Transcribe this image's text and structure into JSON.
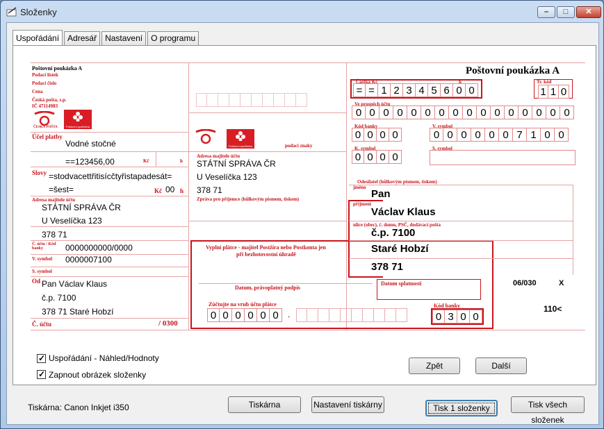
{
  "window": {
    "title": "Složenky",
    "minimize": "–",
    "maximize": "□",
    "close": "✕"
  },
  "tabs": [
    "Uspořádání",
    "Adresář",
    "Nastavení",
    "O programu"
  ],
  "form": {
    "header_small": "Poštovní poukázka A",
    "header_big": "Poštovní poukázka A",
    "labels": {
      "podaci_listek": "Podací lístek",
      "podaci_cislo": "Podací číslo",
      "cena": "Cena",
      "ceska_posta": "Česká pošta, s.p.",
      "ic": "IČ 47114983",
      "ucel_platby": "Účel platby",
      "kc": "Kč",
      "h": "h",
      "slovy": "Slovy",
      "adresa_majitele_left": "Adresa majitele účtu",
      "cislo_uctu_kod": "Č. účtu / Kód banky",
      "v_symbol_left": "V. symbol",
      "s_symbol_left": "S. symbol",
      "od": "Od",
      "c_uctu": "Č. účtu",
      "ucet_suffix": "/ 0300",
      "adresa_majitele_mid": "Adresa majitele účtu",
      "podaci_znaky": "podací znaky",
      "zprava": "Zpráva pro příjemce (hůlkovým písmem, tiskem)",
      "vyplni": "Vyplní plátce - majitel Postžíra nebo Postkonta jen",
      "vyplni2": "při bezhotovostní úhradě",
      "datum_podpis": "Datum, právoplatný podpis",
      "datum_splatnosti": "Datum splatnosti",
      "zuctujte": "Zúčtujte na vrub účtu plátce",
      "kod_banky_bottom": "Kód banky",
      "castka_kc": "Částka Kč",
      "castka_h": "h",
      "tr_kod": "Tr. kód",
      "ve_prospech": "Ve prospěch účtu",
      "kod_banky": "Kód banky",
      "v_symbol": "V. symbol",
      "k_symbol": "K. symbol",
      "s_symbol": "S. symbol",
      "odesilatel": "Odesílatel (hůlkovým písmem, tiskem)",
      "jmeno": "jméno",
      "prijmeni": "příjmení",
      "ulice": "ulice (obec), č. domu, PSČ, dodávací pošta",
      "ceska_posta_logo": "ČESKÁ POŠTA",
      "postovni_sporitelna": "Poštovní spořitelna"
    },
    "values": {
      "ucel": "Vodné stočné",
      "amount_left": "==123456,00",
      "slovy1": "=stodvacettřitisícčtyřistapadesát=",
      "slovy2": "=šest=",
      "kc_h": "00",
      "addr_left_1": "STÁTNÍ SPRÁVA ČR",
      "addr_left_2": "U Veselíčka 123",
      "addr_left_3": "378 71",
      "ucet_left": "0000000000/0000",
      "vsym_left": "0000007100",
      "od_1": "Pan Václav Klaus",
      "od_2": "č.p. 7100",
      "od_3": "378 71  Staré Hobzí",
      "addr_mid_1": "STÁTNÍ SPRÁVA ČR",
      "addr_mid_2": "U Veselíčka 123",
      "addr_mid_3": "378 71",
      "castka": [
        "=",
        "=",
        "1",
        "2",
        "3",
        "4",
        "5",
        "6",
        "0",
        "0"
      ],
      "tr_kod": [
        "1",
        "1",
        "0"
      ],
      "ucet_digits": [
        "0",
        "0",
        "0",
        "0",
        "0",
        "0",
        "0",
        "0",
        "0",
        "0",
        "0",
        "0",
        "0",
        "0",
        "0",
        "0"
      ],
      "kod_banky": [
        "0",
        "0",
        "0",
        "0"
      ],
      "vsym": [
        "0",
        "0",
        "0",
        "0",
        "0",
        "0",
        "7",
        "1",
        "0",
        "0"
      ],
      "ksym": [
        "0",
        "0",
        "0",
        "0"
      ],
      "jmeno": "Pan",
      "prijmeni": "Václav Klaus",
      "ulice": "č.p. 7100",
      "obec": "Staré Hobzí",
      "psc": "378 71",
      "ucet_platce": [
        "0",
        "0",
        "0",
        "0",
        "0",
        "0"
      ],
      "ucet_platce_dot": ".",
      "kod_banky_bottom": [
        "0",
        "3",
        "0",
        "0"
      ],
      "form_id": "06/030",
      "x_mark": "X",
      "ocr": "110<"
    }
  },
  "options": {
    "usporadani": "Uspořádání - Náhled/Hodnoty",
    "zapnout": "Zapnout obrázek složenky",
    "check": "✓"
  },
  "buttons": {
    "zpet": "Zpět",
    "dalsi": "Další",
    "tiskarna": "Tiskárna",
    "nastaveni_tiskarny": "Nastavení tiskárny",
    "tisk_1": "Tisk 1 složenky",
    "tisk_vsech": "Tisk všech složenek"
  },
  "printer": "Tiskárna: Canon Inkjet i350"
}
